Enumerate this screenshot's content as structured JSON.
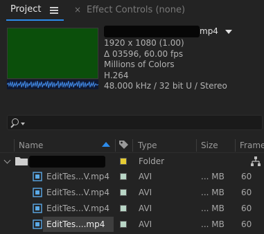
{
  "tabs": {
    "project": "Project",
    "effect_controls": "Effect Controls (none)",
    "close_glyph": "×"
  },
  "asset_info": {
    "name_suffix": "mp4",
    "lines": [
      "1920 x 1080 (1.00)",
      "Δ 03596, 60.00 fps",
      "Millions of Colors",
      "H.264",
      "48.000 kHz / 32 bit U / Stereo"
    ]
  },
  "search": {
    "placeholder": ""
  },
  "columns": {
    "name": "Name",
    "type": "Type",
    "size": "Size",
    "frame": "Frame"
  },
  "rows": [
    {
      "name": "",
      "type": "Folder",
      "size": "",
      "frame": "",
      "label_color": "#e6cc33",
      "kind": "folder"
    },
    {
      "name": "EditTes...V.mp4",
      "type": "AVI",
      "size": "... MB",
      "frame": "60",
      "label_color": "#b9d6c6",
      "kind": "file"
    },
    {
      "name": "EditTes...V.mp4",
      "type": "AVI",
      "size": "... MB",
      "frame": "60",
      "label_color": "#b9d6c6",
      "kind": "file"
    },
    {
      "name": "EditTes...V.mp4",
      "type": "AVI",
      "size": "... MB",
      "frame": "60",
      "label_color": "#b9d6c6",
      "kind": "file"
    },
    {
      "name": "EditTes....mp4",
      "type": "AVI",
      "size": "... MB",
      "frame": "60",
      "label_color": "#b9d6c6",
      "kind": "file",
      "selected": true
    }
  ],
  "colors": {
    "accent": "#2d8ceb",
    "thumbnail": "#0b4f0b",
    "folder_label": "#e6cc33",
    "file_label": "#b9d6c6"
  },
  "icons": [
    "menu-icon",
    "close-icon",
    "search-icon",
    "sort-arrow-icon",
    "tag-icon",
    "folder-icon",
    "footage-icon",
    "flowchart-icon",
    "waveform-icon",
    "dropdown-arrow-icon"
  ]
}
